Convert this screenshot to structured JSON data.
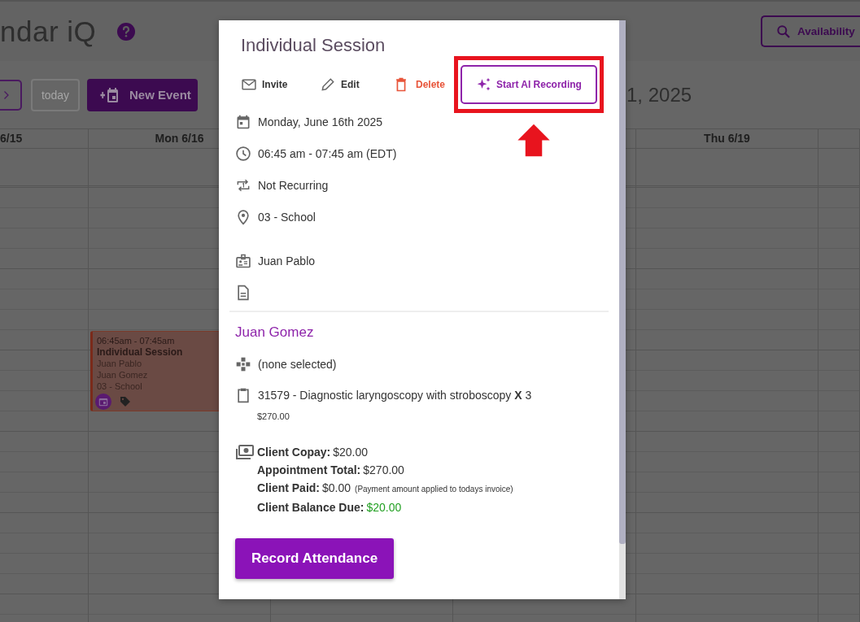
{
  "app_header": {
    "title": "ndar iQ",
    "availability_button": "Availability"
  },
  "toolbar": {
    "today_button": {
      "label": "today",
      "disabled": true
    },
    "new_event_button": "New Event",
    "date_range": "1, 2025"
  },
  "calendar": {
    "columns": [
      {
        "kind": "day",
        "header": "6/15"
      },
      {
        "kind": "day",
        "header": "Mon 6/16",
        "events": [
          {
            "time": "06:45am - 07:45am",
            "title": "Individual Session",
            "lines": [
              "Juan Pablo",
              "Juan Gomez",
              "03 - School"
            ]
          }
        ]
      },
      {
        "kind": "blank"
      },
      {
        "kind": "blank"
      },
      {
        "kind": "day",
        "header": "Thu 6/19"
      },
      {
        "kind": "blank"
      }
    ]
  },
  "dialog": {
    "title": "Individual Session",
    "actions": [
      {
        "kind": "invite",
        "label": "Invite",
        "highlighted": false
      },
      {
        "kind": "edit",
        "label": "Edit",
        "highlighted": false
      },
      {
        "kind": "delete",
        "label": "Delete",
        "highlighted": false
      },
      {
        "kind": "ai",
        "label": "Start AI Recording",
        "highlighted": true
      }
    ],
    "details": [
      {
        "kind": "date",
        "text": "Monday, June 16th 2025"
      },
      {
        "kind": "time",
        "text": "06:45 am - 07:45 am (EDT)"
      },
      {
        "kind": "repeat",
        "text": "Not Recurring"
      },
      {
        "kind": "location",
        "text": "03 - School"
      },
      {
        "kind": "provider",
        "text": "Juan Pablo"
      },
      {
        "kind": "note"
      }
    ],
    "client": {
      "name": "Juan Gomez",
      "items": [
        {
          "kind": "category",
          "text": "(none selected)"
        },
        {
          "kind": "service",
          "text": "31579 - Diagnostic laryngoscopy with stroboscopy **X** 3",
          "price": "$270.00"
        }
      ]
    },
    "billing": [
      {
        "label": "Client Copay:",
        "value": "$20.00"
      },
      {
        "label": "Appointment Total:",
        "value": "$270.00"
      },
      {
        "label": "Client Paid:",
        "value": "$0.00",
        "note": "(Payment amount applied to todays invoice)"
      },
      {
        "label": "Client Balance Due:",
        "value": "$20.00",
        "color": "#22a022"
      }
    ],
    "record_button": "Record Attendance"
  }
}
